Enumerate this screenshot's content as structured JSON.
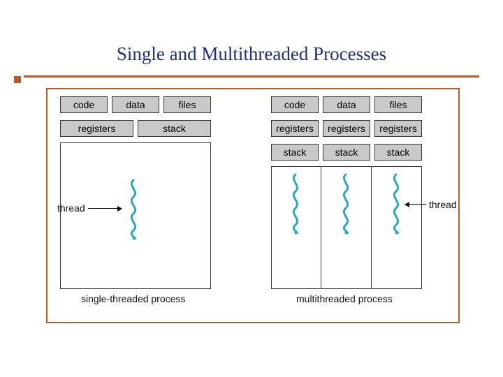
{
  "title": "Single and Multithreaded Processes",
  "left": {
    "row1": [
      "code",
      "data",
      "files"
    ],
    "row2": [
      "registers",
      "stack"
    ],
    "label": "thread",
    "caption": "single-threaded process"
  },
  "right": {
    "row1": [
      "code",
      "data",
      "files"
    ],
    "row2": [
      "registers",
      "registers",
      "registers"
    ],
    "row3": [
      "stack",
      "stack",
      "stack"
    ],
    "label": "thread",
    "caption": "multithreaded process"
  }
}
